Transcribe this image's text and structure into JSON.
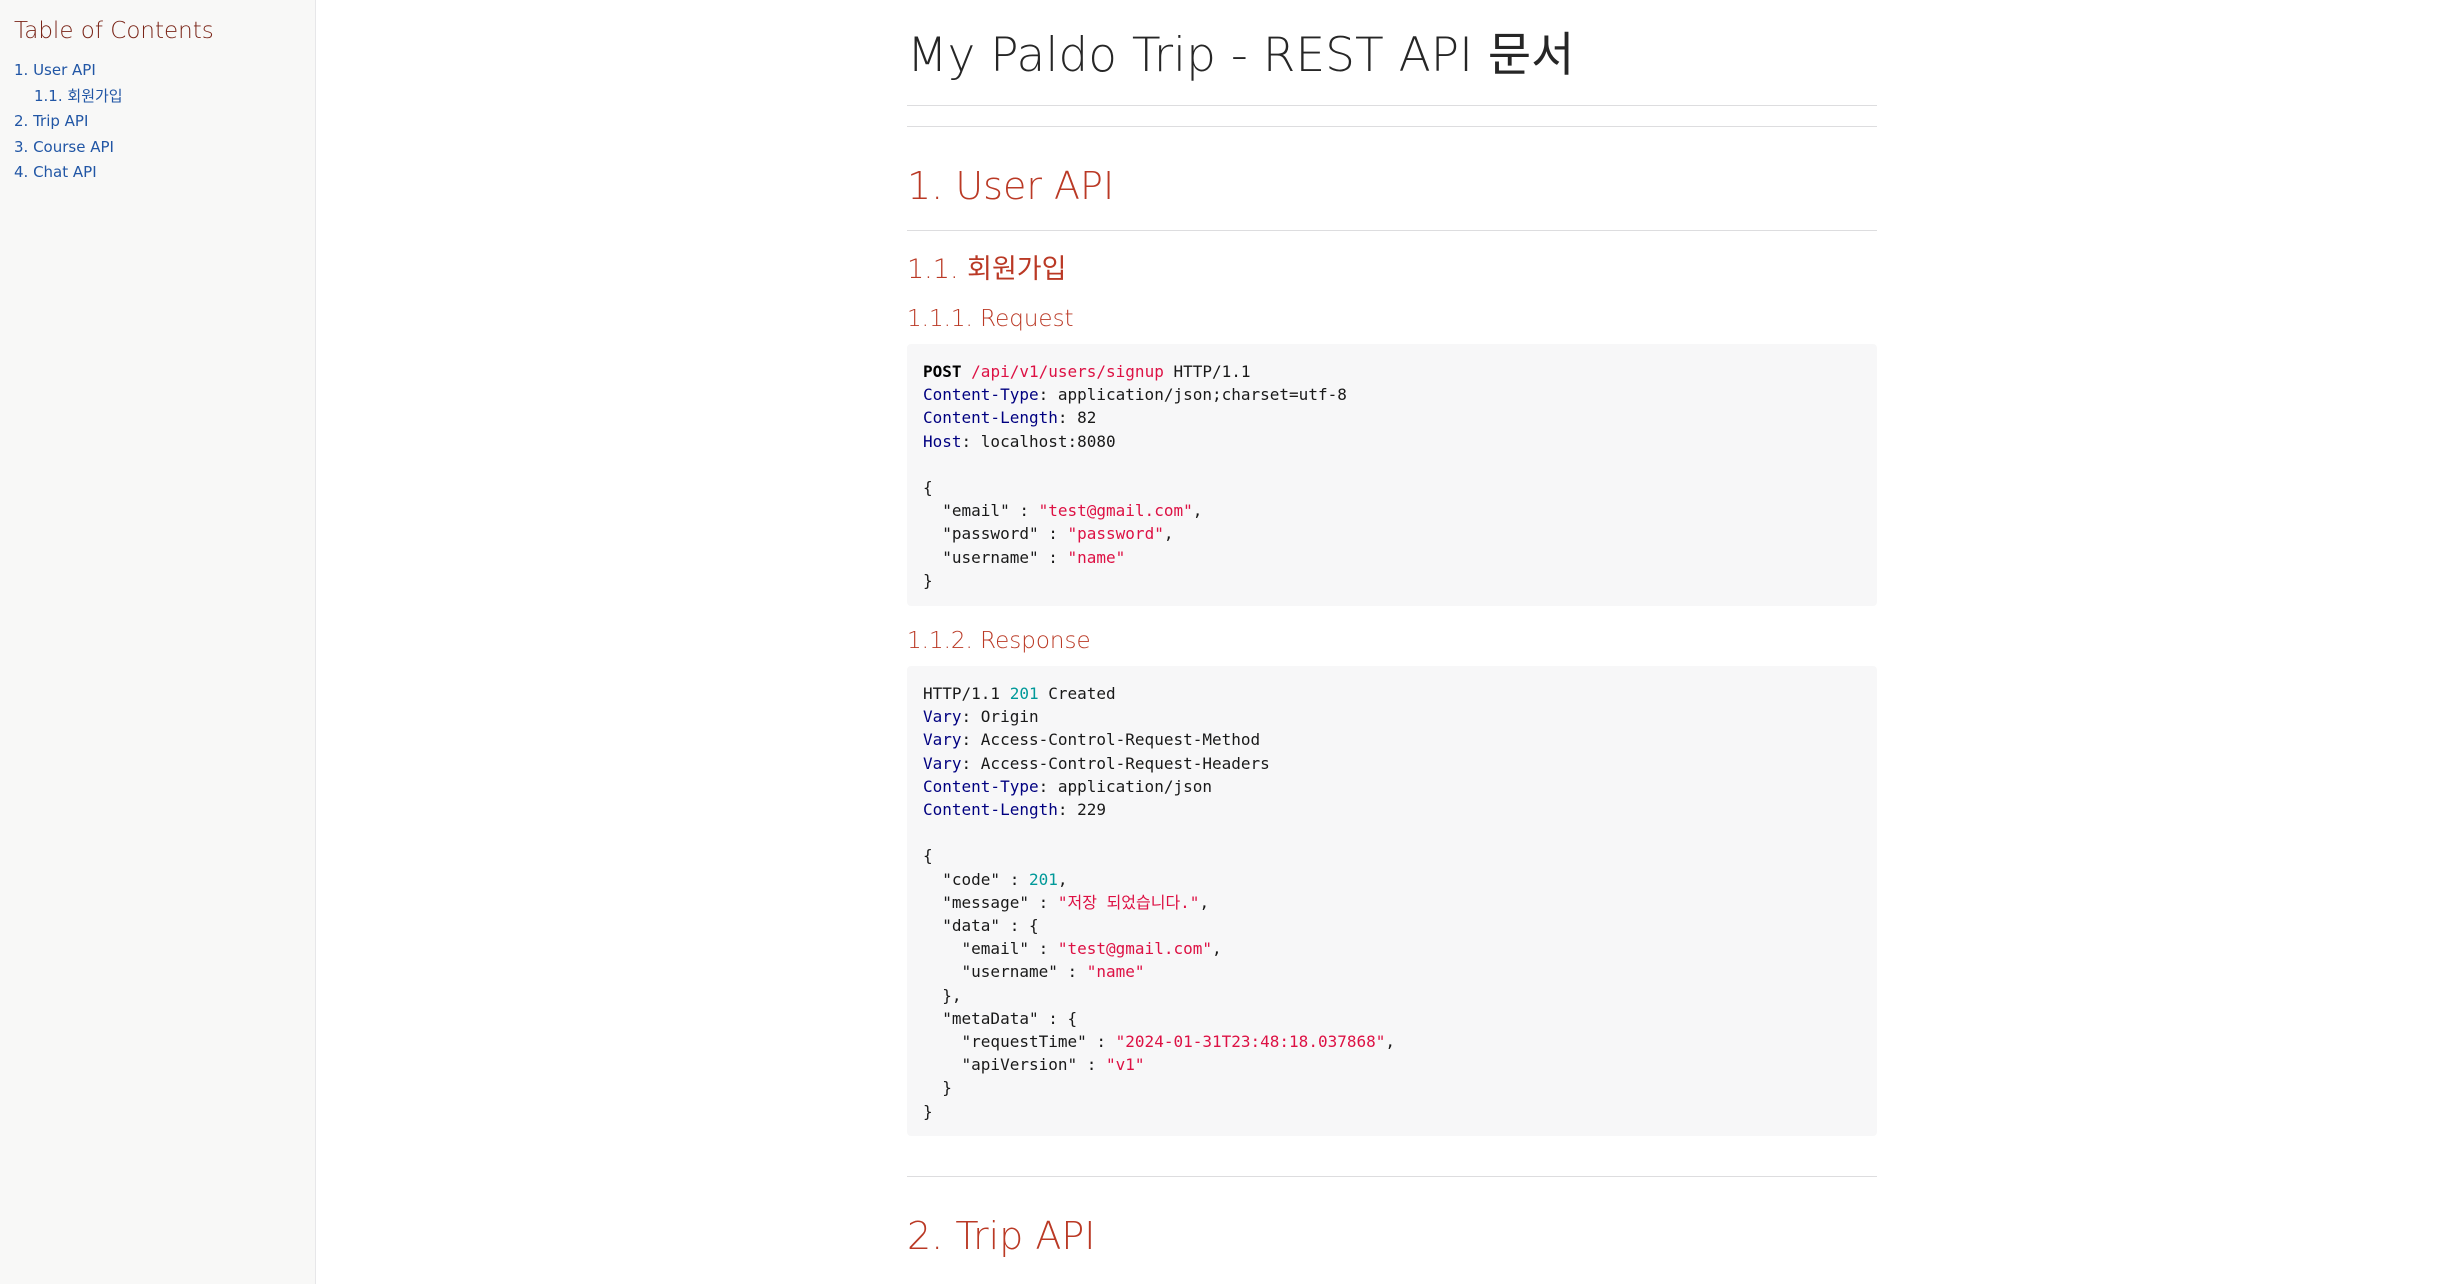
{
  "toc": {
    "title": "Table of Contents",
    "items": [
      {
        "label": "1. User API"
      },
      {
        "label": "1.1. 회원가입"
      },
      {
        "label": "2. Trip API"
      },
      {
        "label": "3. Course API"
      },
      {
        "label": "4. Chat API"
      }
    ]
  },
  "doc": {
    "title": "My Paldo Trip - REST API 문서",
    "section1": "1. User API",
    "section1_1": "1.1. 회원가입",
    "request_heading": "1.1.1. Request",
    "response_heading": "1.1.2. Response",
    "section2": "2. Trip API"
  },
  "request": {
    "method": "POST",
    "path": "/api/v1/users/signup",
    "protocol": " HTTP/1.1",
    "headers": [
      {
        "name": "Content-Type",
        "value": ": application/json;charset=utf-8"
      },
      {
        "name": "Content-Length",
        "value": ": 82"
      },
      {
        "name": "Host",
        "value": ": localhost:8080"
      }
    ],
    "body": {
      "open": "{",
      "email_key": "  \"email\" : ",
      "email_val": "\"test@gmail.com\"",
      "password_key": "  \"password\" : ",
      "password_val": "\"password\"",
      "username_key": "  \"username\" : ",
      "username_val": "\"name\"",
      "close": "}"
    }
  },
  "response": {
    "protocol": "HTTP/1.1 ",
    "status_code": "201",
    "status_text": " Created",
    "headers": [
      {
        "name": "Vary",
        "value": ": Origin"
      },
      {
        "name": "Vary",
        "value": ": Access-Control-Request-Method"
      },
      {
        "name": "Vary",
        "value": ": Access-Control-Request-Headers"
      },
      {
        "name": "Content-Type",
        "value": ": application/json"
      },
      {
        "name": "Content-Length",
        "value": ": 229"
      }
    ],
    "body": {
      "open": "{",
      "code_key": "  \"code\" : ",
      "code_val": "201",
      "message_key": "  \"message\" : ",
      "message_val": "\"저장 되었습니다.\"",
      "data_open": "  \"data\" : {",
      "email_key": "    \"email\" : ",
      "email_val": "\"test@gmail.com\"",
      "username_key": "    \"username\" : ",
      "username_val": "\"name\"",
      "data_close": "  },",
      "meta_open": "  \"metaData\" : {",
      "time_key": "    \"requestTime\" : ",
      "time_val": "\"2024-01-31T23:48:18.037868\"",
      "ver_key": "    \"apiVersion\" : ",
      "ver_val": "\"v1\"",
      "meta_close": "  }",
      "close": "}"
    }
  }
}
